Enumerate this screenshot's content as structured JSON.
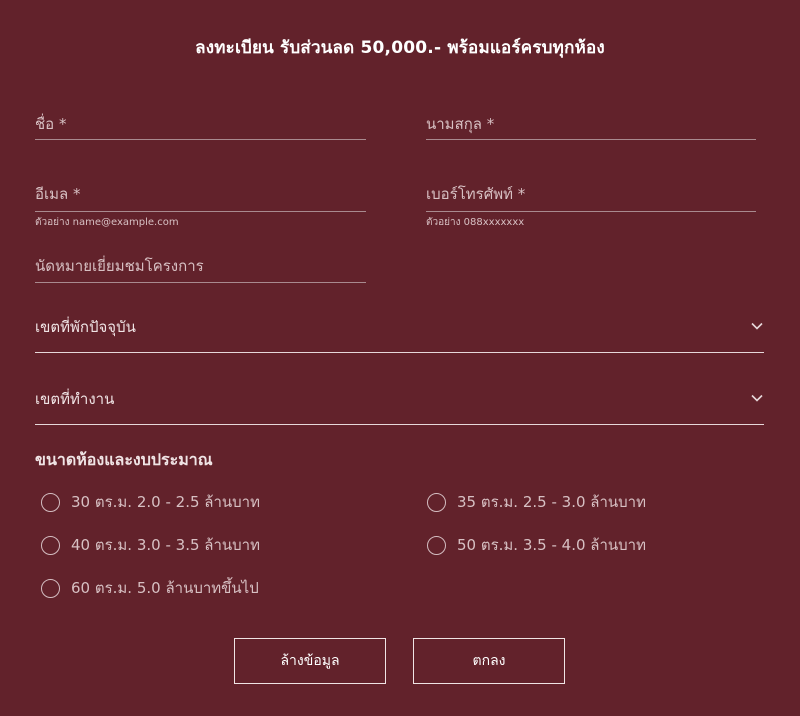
{
  "form": {
    "title": "ลงทะเบียน รับส่วนลด 50,000.- พร้อมแอร์ครบทุกห้อง",
    "fields": {
      "first_name": {
        "label": "ชื่อ *"
      },
      "last_name": {
        "label": "นามสกุล *"
      },
      "email": {
        "label": "อีเมล *",
        "hint": "ตัวอย่าง name@example.com"
      },
      "phone": {
        "label": "เบอร์โทรศัพท์ *",
        "hint": "ตัวอย่าง 088xxxxxxx"
      },
      "appointment": {
        "label": "นัดหมายเยี่ยมชมโครงการ"
      }
    },
    "selects": {
      "residence_district": {
        "label": "เขตที่พักปัจจุบัน",
        "icon": "chevron-down-icon"
      },
      "work_district": {
        "label": "เขตที่ทำงาน",
        "icon": "chevron-down-icon"
      }
    },
    "room_budget": {
      "title": "ขนาดห้องและงบประมาณ",
      "options": [
        "30 ตร.ม. 2.0 - 2.5 ล้านบาท",
        "35 ตร.ม. 2.5 - 3.0 ล้านบาท",
        "40 ตร.ม. 3.0 - 3.5 ล้านบาท",
        "50 ตร.ม. 3.5 - 4.0 ล้านบาท",
        "60 ตร.ม. 5.0 ล้านบาทขึ้นไป"
      ]
    },
    "buttons": {
      "clear": "ล้างข้อมูล",
      "submit": "ตกลง"
    },
    "colors": {
      "background": "#62222b",
      "text": "#d7c0c3",
      "accent": "#ffffff"
    }
  }
}
